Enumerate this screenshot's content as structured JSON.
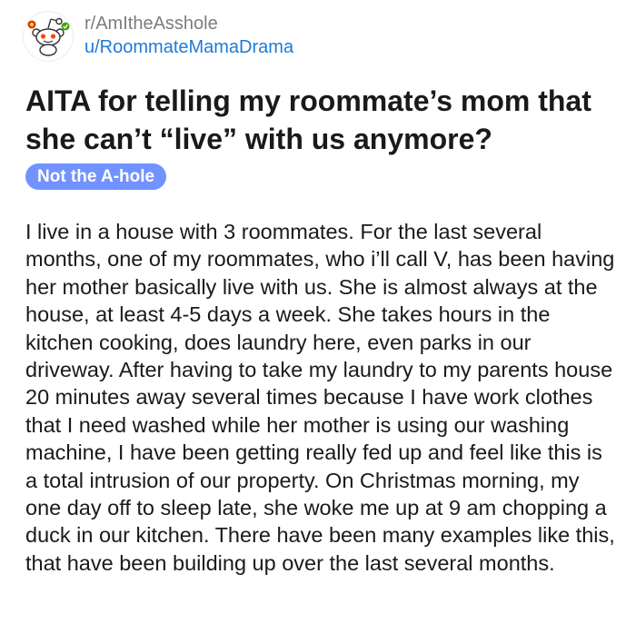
{
  "post": {
    "subreddit": "r/AmItheAsshole",
    "username": "u/RoommateMamaDrama",
    "avatar_icon": "reddit-snoo-icon",
    "title": "AITA for telling my roommate’s mom that she can’t “live” with us anymore?",
    "flair": "Not the A-hole",
    "flair_color": "#7193ff",
    "body": "I live in a house with 3 roommates. For the last several months, one of my roommates, who i’ll call V, has been having her mother basically live with us. She is almost always at the house, at least 4-5 days a week. She takes hours in the kitchen cooking, does laundry here, even parks in our driveway. After having to take my laundry to my parents house 20 minutes away several times because I have work clothes that I need washed while her mother is using our washing machine, I have been getting really fed up and feel like this is a total intrusion of our property. On Christmas morning, my one day off to sleep late, she woke me up at 9 am chopping a duck in our kitchen. There have been many examples like this, that have been building up over the last several months."
  },
  "colors": {
    "subreddit_text": "#7c7c7c",
    "username_link": "#1e7ad6",
    "text": "#1a1a1b"
  }
}
